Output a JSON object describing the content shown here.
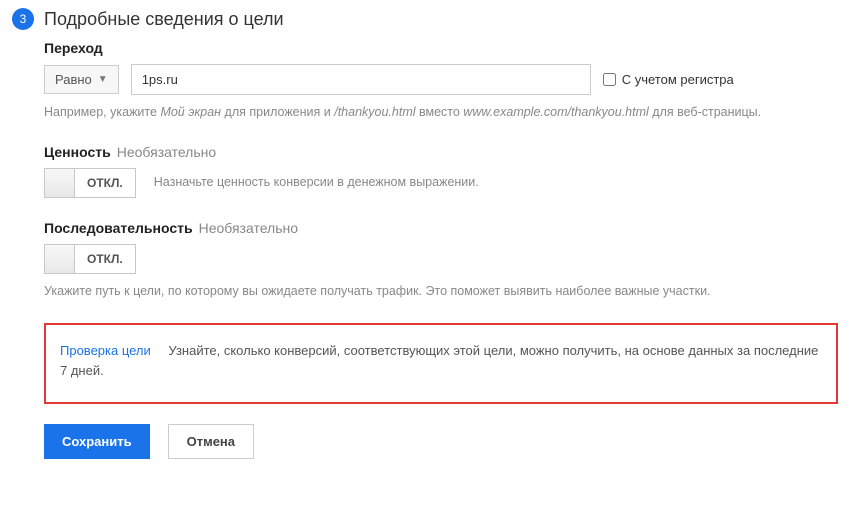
{
  "step": {
    "number": "3",
    "title": "Подробные сведения о цели"
  },
  "destination": {
    "heading": "Переход",
    "match_type": "Равно",
    "value": "1ps.ru",
    "case_sensitive_label": "С учетом регистра",
    "hint_prefix": "Например, укажите ",
    "hint_em1": "Мой экран",
    "hint_mid1": " для приложения и ",
    "hint_em2": "/thankyou.html",
    "hint_mid2": " вместо ",
    "hint_em3": "www.example.com/thankyou.html",
    "hint_suffix": " для веб-страницы."
  },
  "value_section": {
    "heading": "Ценность",
    "optional": "Необязательно",
    "toggle_label": "ОТКЛ.",
    "hint": "Назначьте ценность конверсии в денежном выражении."
  },
  "funnel_section": {
    "heading": "Последовательность",
    "optional": "Необязательно",
    "toggle_label": "ОТКЛ.",
    "hint": "Укажите путь к цели, по которому вы ожидаете получать трафик. Это поможет выявить наиболее важные участки."
  },
  "verify": {
    "link": "Проверка цели",
    "text": "Узнайте, сколько конверсий, соответствующих этой цели, можно получить, на основе данных за последние 7 дней."
  },
  "buttons": {
    "save": "Сохранить",
    "cancel": "Отмена"
  }
}
